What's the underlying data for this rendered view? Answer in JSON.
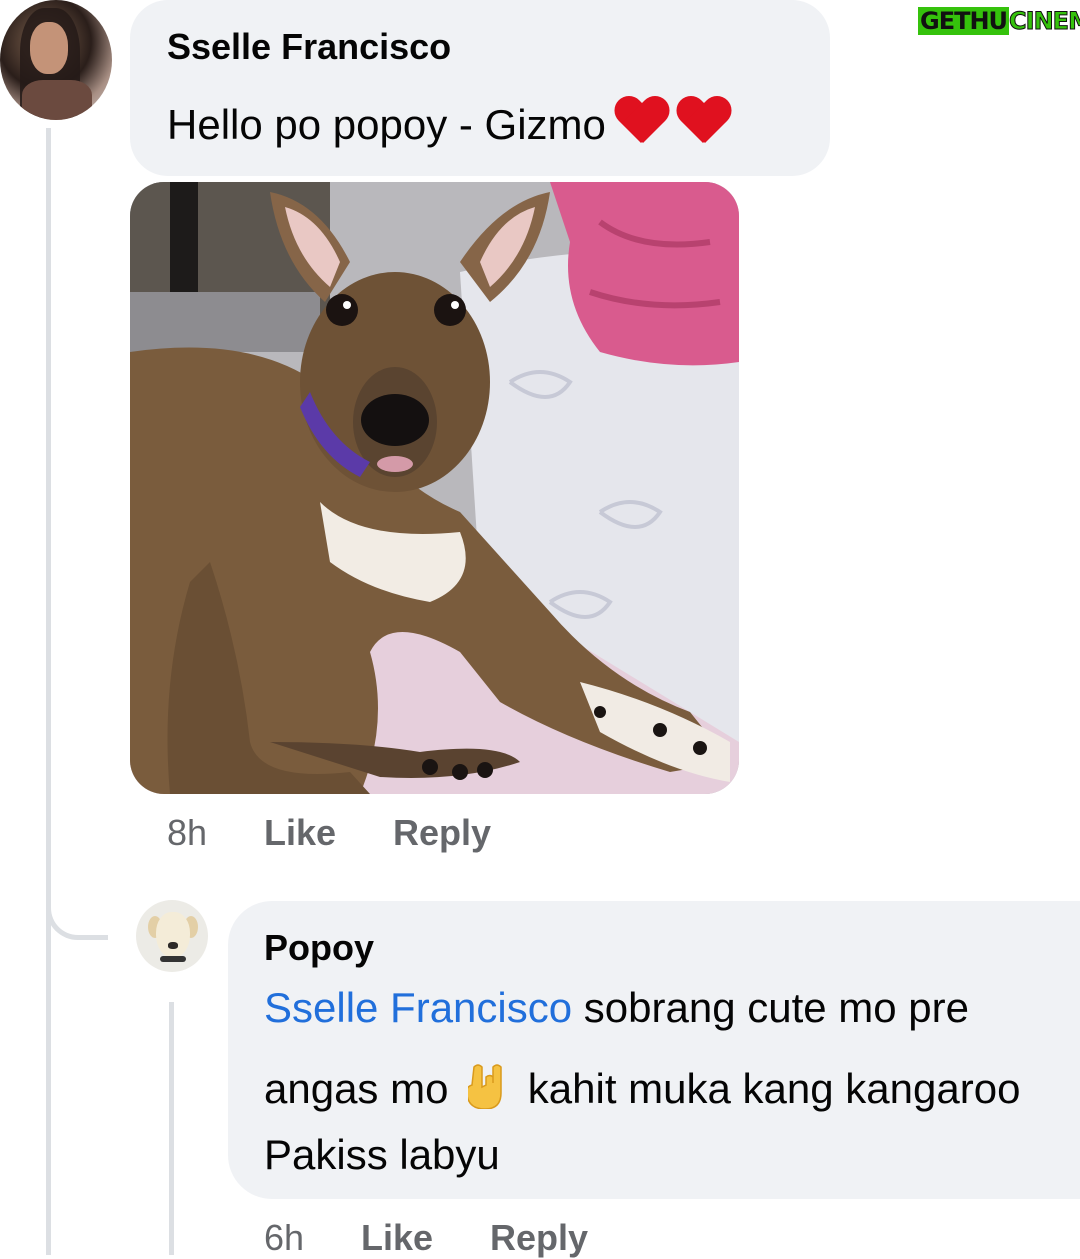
{
  "watermark": {
    "part1": "GETHU",
    "part2": "CINEMA"
  },
  "comment": {
    "author": "Sselle Francisco",
    "text": "Hello po popoy - Gizmo",
    "emoji": "red-heart x2",
    "photo": "brindle dog lying on bed with purple collar",
    "time": "8h",
    "like_label": "Like",
    "reply_label": "Reply"
  },
  "reply": {
    "author": "Popoy",
    "mention": "Sselle Francisco",
    "line1_rest": " sobrang cute mo pre",
    "line2_a": "angas mo ",
    "line2_b": " kahit muka kang kangaroo",
    "line3": "Pakiss labyu",
    "time": "6h",
    "like_label": "Like",
    "reply_label": "Reply"
  },
  "colors": {
    "bubble": "#f0f2f5",
    "mention": "#216fdb",
    "secondary_text": "#65676b",
    "heart": "#e0111f"
  }
}
